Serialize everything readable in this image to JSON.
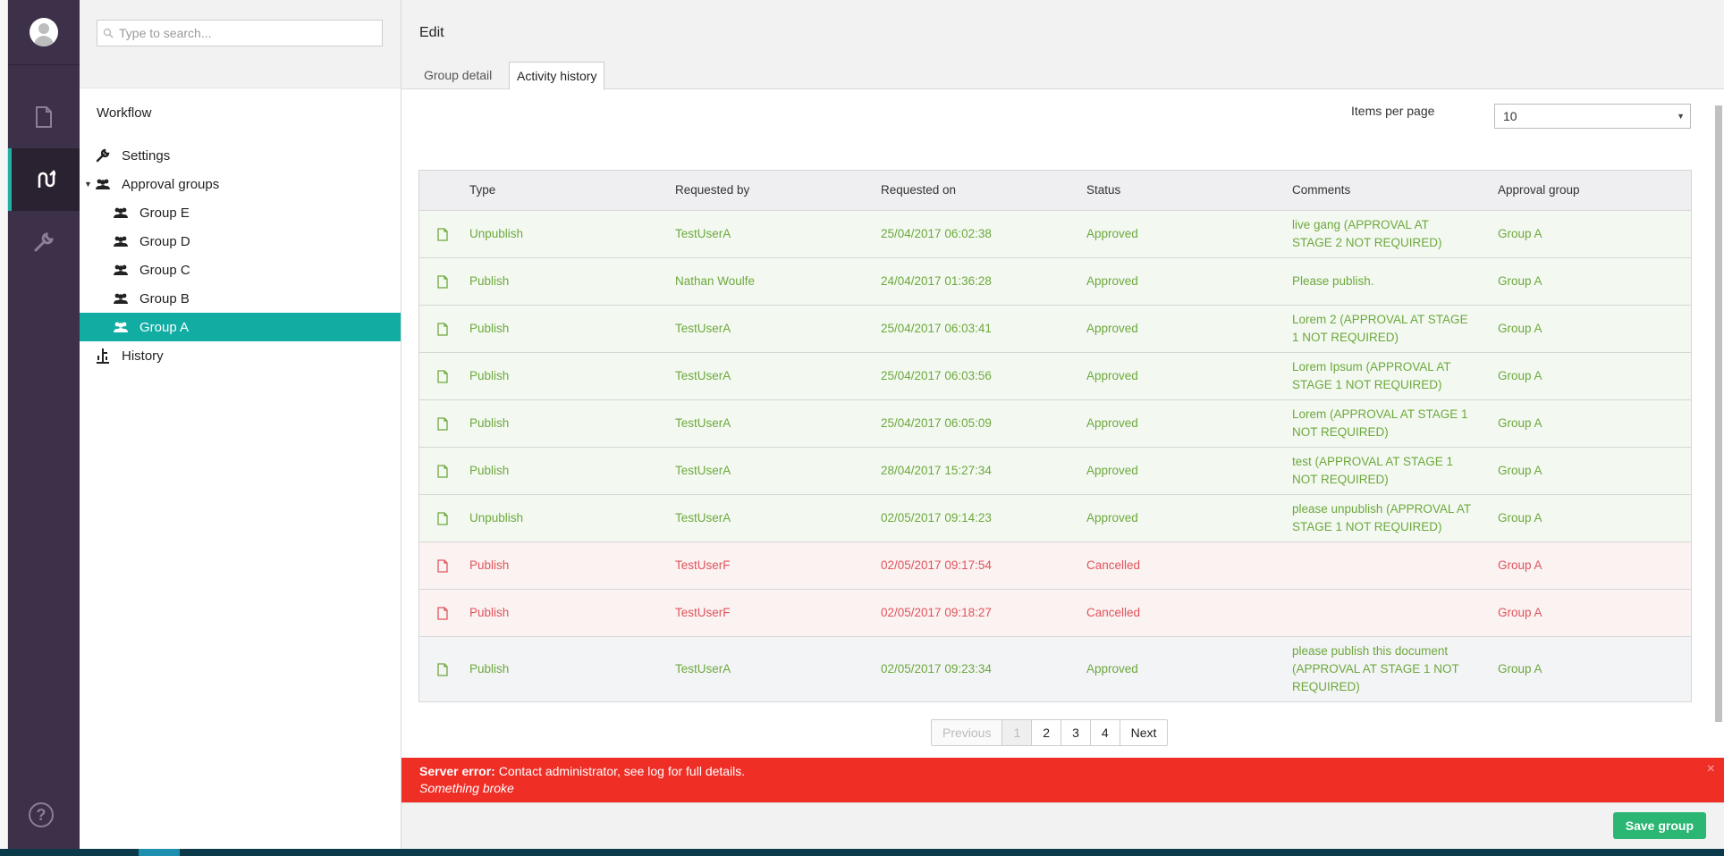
{
  "search": {
    "placeholder": "Type to search..."
  },
  "icons": {
    "avatar": "user-avatar-icon",
    "content": "document-icon",
    "workflow": "workflow-icon",
    "developer": "wrench-icon",
    "help": "help-icon"
  },
  "help_glyph": "?",
  "tree": {
    "section_title": "Workflow",
    "settings": "Settings",
    "approval_groups": "Approval groups",
    "groups": [
      "Group E",
      "Group D",
      "Group C",
      "Group B",
      "Group A"
    ],
    "history": "History"
  },
  "header": {
    "title": "Edit",
    "tabs": [
      "Group detail",
      "Activity history"
    ]
  },
  "items_per_page": {
    "label": "Items per page",
    "value": "10"
  },
  "table": {
    "columns": [
      "Type",
      "Requested by",
      "Requested on",
      "Status",
      "Comments",
      "Approval group"
    ],
    "rows": [
      {
        "type": "Unpublish",
        "by": "TestUserA",
        "on": "25/04/2017 06:02:38",
        "status": "Approved",
        "comment": "live gang (APPROVAL AT STAGE 2 NOT REQUIRED)",
        "group": "Group A"
      },
      {
        "type": "Publish",
        "by": "Nathan Woulfe",
        "on": "24/04/2017 01:36:28",
        "status": "Approved",
        "comment": "Please publish.",
        "group": "Group A"
      },
      {
        "type": "Publish",
        "by": "TestUserA",
        "on": "25/04/2017 06:03:41",
        "status": "Approved",
        "comment": "Lorem 2 (APPROVAL AT STAGE 1 NOT REQUIRED)",
        "group": "Group A"
      },
      {
        "type": "Publish",
        "by": "TestUserA",
        "on": "25/04/2017 06:03:56",
        "status": "Approved",
        "comment": "Lorem Ipsum (APPROVAL AT STAGE 1 NOT REQUIRED)",
        "group": "Group A"
      },
      {
        "type": "Publish",
        "by": "TestUserA",
        "on": "25/04/2017 06:05:09",
        "status": "Approved",
        "comment": "Lorem (APPROVAL AT STAGE 1 NOT REQUIRED)",
        "group": "Group A"
      },
      {
        "type": "Publish",
        "by": "TestUserA",
        "on": "28/04/2017 15:27:34",
        "status": "Approved",
        "comment": "test (APPROVAL AT STAGE 1 NOT REQUIRED)",
        "group": "Group A"
      },
      {
        "type": "Unpublish",
        "by": "TestUserA",
        "on": "02/05/2017 09:14:23",
        "status": "Approved",
        "comment": "please unpublish (APPROVAL AT STAGE 1 NOT REQUIRED)",
        "group": "Group A"
      },
      {
        "type": "Publish",
        "by": "TestUserF",
        "on": "02/05/2017 09:17:54",
        "status": "Cancelled",
        "comment": "",
        "group": "Group A"
      },
      {
        "type": "Publish",
        "by": "TestUserF",
        "on": "02/05/2017 09:18:27",
        "status": "Cancelled",
        "comment": "",
        "group": "Group A"
      },
      {
        "type": "Publish",
        "by": "TestUserA",
        "on": "02/05/2017 09:23:34",
        "status": "Approved",
        "comment": "please publish this document (APPROVAL AT STAGE 1 NOT REQUIRED)",
        "group": "Group A"
      }
    ]
  },
  "pagination": {
    "previous": "Previous",
    "pages": [
      "1",
      "2",
      "3",
      "4"
    ],
    "next": "Next"
  },
  "error": {
    "title": "Server error:",
    "message": "Contact administrator, see log for full details.",
    "detail": "Something broke",
    "close": "×"
  },
  "footer": {
    "save_label": "Save group"
  },
  "colors": {
    "nav_bg": "#3d3049",
    "accent": "#11ada3",
    "approved": "#6da83d",
    "cancelled": "#e0545b",
    "error_bg": "#ef2e26",
    "save_bg": "#2bb673"
  }
}
